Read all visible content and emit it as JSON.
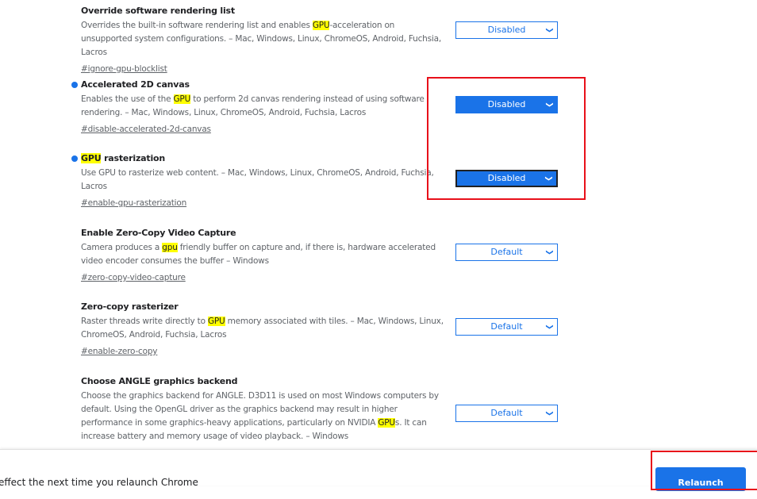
{
  "flags": [
    {
      "title_pre": "",
      "title_hl": "",
      "title_post": "Override software rendering list",
      "modified": false,
      "desc_pre": "Overrides the built-in software rendering list and enables ",
      "desc_hl": "GPU",
      "desc_post": "-acceleration on unsupported system configurations. – Mac, Windows, Linux, ChromeOS, Android, Fuchsia, Lacros",
      "link": "#ignore-gpu-blocklist",
      "value": "Disabled"
    },
    {
      "title_pre": "",
      "title_hl": "",
      "title_post": "Accelerated 2D canvas",
      "modified": true,
      "desc_pre": "Enables the use of the ",
      "desc_hl": "GPU",
      "desc_post": " to perform 2d canvas rendering instead of using software rendering. – Mac, Windows, Linux, ChromeOS, Android, Fuchsia, Lacros",
      "link": "#disable-accelerated-2d-canvas",
      "value": "Disabled"
    },
    {
      "title_pre": "",
      "title_hl": "GPU",
      "title_post": " rasterization",
      "modified": true,
      "desc_pre": "Use GPU to rasterize web content. – Mac, Windows, Linux, ChromeOS, Android, Fuchsia, Lacros",
      "desc_hl": "",
      "desc_post": "",
      "link": "#enable-gpu-rasterization",
      "value": "Disabled"
    },
    {
      "title_pre": "",
      "title_hl": "",
      "title_post": "Enable Zero-Copy Video Capture",
      "modified": false,
      "desc_pre": "Camera produces a ",
      "desc_hl": "gpu",
      "desc_post": " friendly buffer on capture and, if there is, hardware accelerated video encoder consumes the buffer – Windows",
      "link": "#zero-copy-video-capture",
      "value": "Default"
    },
    {
      "title_pre": "",
      "title_hl": "",
      "title_post": "Zero-copy rasterizer",
      "modified": false,
      "desc_pre": "Raster threads write directly to ",
      "desc_hl": "GPU",
      "desc_post": " memory associated with tiles. – Mac, Windows, Linux, ChromeOS, Android, Fuchsia, Lacros",
      "link": "#enable-zero-copy",
      "value": "Default"
    },
    {
      "title_pre": "",
      "title_hl": "",
      "title_post": "Choose ANGLE graphics backend",
      "modified": false,
      "desc_pre": "Choose the graphics backend for ANGLE. D3D11 is used on most Windows computers by default. Using the OpenGL driver as the graphics backend may result in higher performance in some graphics-heavy applications, particularly on NVIDIA ",
      "desc_hl": "GPU",
      "desc_post": "s. It can increase battery and memory usage of video playback. – Windows",
      "link": "#use-angle",
      "value": "Default"
    }
  ],
  "footer": {
    "message": "effect the next time you relaunch Chrome",
    "relaunch": "Relaunch"
  },
  "colors": {
    "accent": "#1a73e8",
    "highlight": "#ffff00",
    "annotation": "#e8101a"
  }
}
